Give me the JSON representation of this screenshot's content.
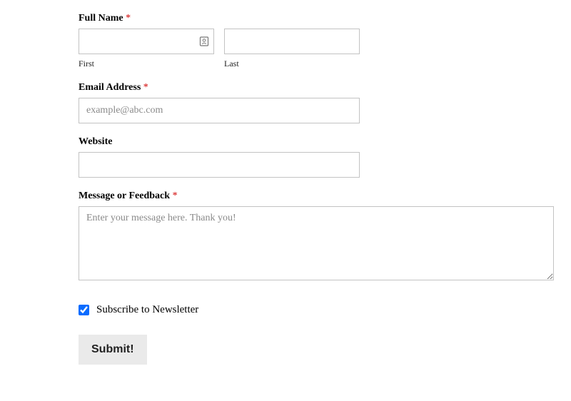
{
  "form": {
    "fullName": {
      "label": "Full Name",
      "required": "*",
      "first": {
        "sublabel": "First",
        "value": ""
      },
      "last": {
        "sublabel": "Last",
        "value": ""
      }
    },
    "email": {
      "label": "Email Address",
      "required": "*",
      "placeholder": "example@abc.com",
      "value": ""
    },
    "website": {
      "label": "Website",
      "value": ""
    },
    "message": {
      "label": "Message or Feedback",
      "required": "*",
      "placeholder": "Enter your message here. Thank you!",
      "value": ""
    },
    "newsletter": {
      "label": "Subscribe to Newsletter",
      "checked": true
    },
    "submit": {
      "label": "Submit!"
    }
  }
}
